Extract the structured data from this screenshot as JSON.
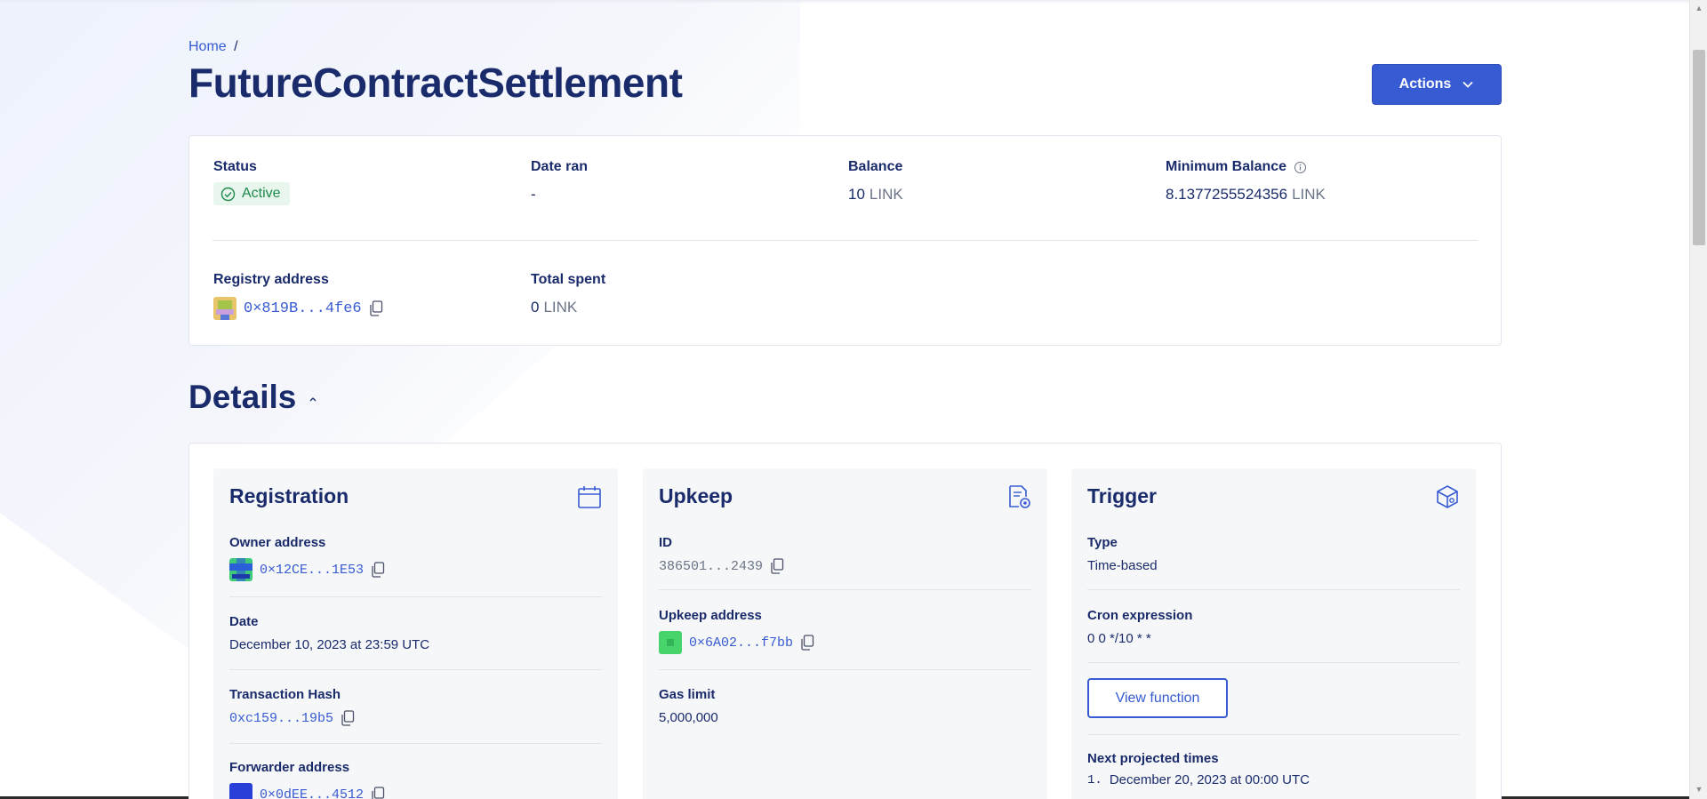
{
  "breadcrumb": {
    "home": "Home",
    "separator": "/"
  },
  "page_title": "FutureContractSettlement",
  "actions_label": "Actions",
  "summary": {
    "status_label": "Status",
    "status_value": "Active",
    "date_ran_label": "Date ran",
    "date_ran_value": "-",
    "balance_label": "Balance",
    "balance_amount": "10",
    "balance_unit": "LINK",
    "min_balance_label": "Minimum Balance",
    "min_balance_amount": "8.1377255524356",
    "min_balance_unit": "LINK",
    "registry_label": "Registry address",
    "registry_address": "0×819B...4fe6",
    "total_spent_label": "Total spent",
    "total_spent_amount": "0",
    "total_spent_unit": "LINK"
  },
  "details_heading": "Details",
  "registration": {
    "title": "Registration",
    "owner_label": "Owner address",
    "owner_address": "0×12CE...1E53",
    "date_label": "Date",
    "date_value": "December 10, 2023 at 23:59 UTC",
    "tx_label": "Transaction Hash",
    "tx_value": "0xc159...19b5",
    "forwarder_label": "Forwarder address",
    "forwarder_value": "0×0dEE...4512"
  },
  "upkeep": {
    "title": "Upkeep",
    "id_label": "ID",
    "id_value": "386501...2439",
    "address_label": "Upkeep address",
    "address_value": "0×6A02...f7bb",
    "gas_label": "Gas limit",
    "gas_value": "5,000,000"
  },
  "trigger": {
    "title": "Trigger",
    "type_label": "Type",
    "type_value": "Time-based",
    "cron_label": "Cron expression",
    "cron_value": "0 0 */10 * *",
    "view_function_label": "View function",
    "next_times_label": "Next projected times",
    "next_times": [
      "December 20, 2023 at 00:00 UTC"
    ],
    "next_times_index": "1."
  },
  "colors": {
    "accent": "#375bd2",
    "text": "#1a2b6b",
    "success": "#1d8a4b"
  }
}
